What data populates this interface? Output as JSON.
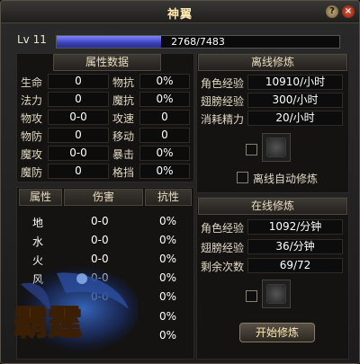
{
  "window": {
    "title": "神翼",
    "help_label": "?",
    "close_label": "×"
  },
  "level": {
    "label": "Lv 11",
    "exp_text": "2768/7483",
    "exp_fraction": 0.37
  },
  "attributes": {
    "header": "属性数据",
    "left": [
      {
        "label": "生命",
        "value": "0"
      },
      {
        "label": "法力",
        "value": "0"
      },
      {
        "label": "物攻",
        "value": "0-0"
      },
      {
        "label": "物防",
        "value": "0"
      },
      {
        "label": "魔攻",
        "value": "0-0"
      },
      {
        "label": "魔防",
        "value": "0"
      }
    ],
    "right": [
      {
        "label": "物抗",
        "value": "0%"
      },
      {
        "label": "魔抗",
        "value": "0%"
      },
      {
        "label": "攻速",
        "value": "0"
      },
      {
        "label": "移动",
        "value": "0"
      },
      {
        "label": "暴击",
        "value": "0%"
      },
      {
        "label": "格挡",
        "value": "0%"
      }
    ]
  },
  "elements": {
    "headers": [
      "属性",
      "伤害",
      "抗性"
    ],
    "rows": [
      {
        "name": "地",
        "damage": "0-0",
        "resist": "0%"
      },
      {
        "name": "水",
        "damage": "0-0",
        "resist": "0%"
      },
      {
        "name": "火",
        "damage": "0-0",
        "resist": "0%"
      },
      {
        "name": "风",
        "damage": "0-0",
        "resist": "0%"
      },
      {
        "name": "",
        "damage": "0-0",
        "resist": "0%"
      },
      {
        "name": "",
        "damage": "",
        "resist": "0%"
      },
      {
        "name": "",
        "damage": "",
        "resist": "0%"
      }
    ]
  },
  "offline": {
    "header": "离线修炼",
    "rows": [
      {
        "label": "角色经验",
        "value": "10910/小时"
      },
      {
        "label": "翅膀经验",
        "value": "300/小时"
      },
      {
        "label": "消耗精力",
        "value": "20/小时"
      }
    ],
    "auto_label": "离线自动修炼"
  },
  "online": {
    "header": "在线修炼",
    "rows": [
      {
        "label": "角色经验",
        "value": "1092/分钟"
      },
      {
        "label": "翅膀经验",
        "value": "36/分钟"
      },
      {
        "label": "剩余次数",
        "value": "69/72"
      }
    ],
    "start_label": "开始修炼"
  },
  "logo": {
    "text": "霸霆"
  }
}
